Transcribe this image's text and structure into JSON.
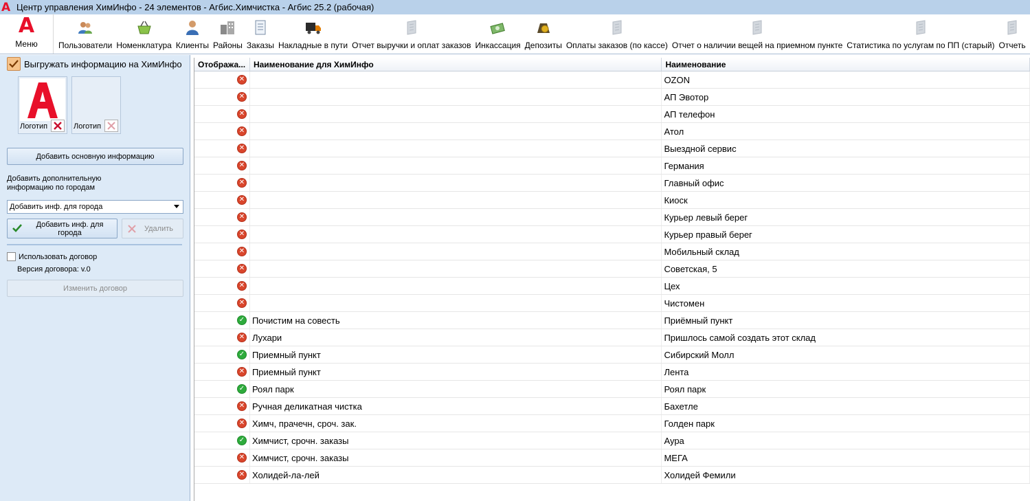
{
  "window": {
    "title": "Центр управления ХимИнфо - 24 элементов - Агбис.Химчистка - Агбис 25.2 (рабочая)"
  },
  "toolbar": {
    "menu_label": "Меню",
    "items": [
      {
        "label": "Пользователи",
        "icon": "users-icon"
      },
      {
        "label": "Номенклатура",
        "icon": "basket-icon"
      },
      {
        "label": "Клиенты",
        "icon": "client-icon"
      },
      {
        "label": "Районы",
        "icon": "buildings-icon"
      },
      {
        "label": "Заказы",
        "icon": "document-icon"
      },
      {
        "label": "Накладные в пути",
        "icon": "truck-icon"
      },
      {
        "label": "Отчет выручки и оплат заказов",
        "icon": "report-icon"
      },
      {
        "label": "Инкассация",
        "icon": "money-icon"
      },
      {
        "label": "Депозиты",
        "icon": "coin-bag-icon"
      },
      {
        "label": "Оплаты заказов (по кассе)",
        "icon": "report-icon"
      },
      {
        "label": "Отчет о наличии вещей на приемном пункте",
        "icon": "report-icon"
      },
      {
        "label": "Статистика по услугам по ПП (старый)",
        "icon": "report-icon"
      },
      {
        "label": "Отчеть",
        "icon": "report-icon"
      }
    ]
  },
  "left": {
    "export_label": "Выгружать информацию на ХимИнфо",
    "logo1_caption": "Логотип",
    "logo2_caption": "Логотип",
    "add_main_info": "Добавить основную информацию",
    "add_extra_info_label": "Добавить дополнительную информацию по городам",
    "city_select_value": "Добавить инф. для города",
    "add_city_button": "Добавить инф. для города",
    "delete_button": "Удалить",
    "use_contract_label": "Использовать договор",
    "contract_version": "Версия договора: v.0",
    "change_contract": "Изменить договор"
  },
  "grid": {
    "columns": [
      "Отобража...",
      "Наименование для ХимИнфо",
      "Наименование"
    ],
    "rows": [
      {
        "shown": false,
        "himinfo_name": "",
        "name": "OZON"
      },
      {
        "shown": false,
        "himinfo_name": "",
        "name": "АП Эвотор"
      },
      {
        "shown": false,
        "himinfo_name": "",
        "name": "АП телефон"
      },
      {
        "shown": false,
        "himinfo_name": "",
        "name": "Атол"
      },
      {
        "shown": false,
        "himinfo_name": "",
        "name": "Выездной сервис"
      },
      {
        "shown": false,
        "himinfo_name": "",
        "name": "Германия"
      },
      {
        "shown": false,
        "himinfo_name": "",
        "name": "Главный офис"
      },
      {
        "shown": false,
        "himinfo_name": "",
        "name": "Киоск"
      },
      {
        "shown": false,
        "himinfo_name": "",
        "name": "Курьер левый берег"
      },
      {
        "shown": false,
        "himinfo_name": "",
        "name": "Курьер правый берег"
      },
      {
        "shown": false,
        "himinfo_name": "",
        "name": "Мобильный склад"
      },
      {
        "shown": false,
        "himinfo_name": "",
        "name": "Советская, 5"
      },
      {
        "shown": false,
        "himinfo_name": "",
        "name": "Цех"
      },
      {
        "shown": false,
        "himinfo_name": "",
        "name": "Чистомен"
      },
      {
        "shown": true,
        "himinfo_name": "Почистим на совесть",
        "name": "Приёмный пункт"
      },
      {
        "shown": false,
        "himinfo_name": "Лухари",
        "name": "Пришлось самой создать этот склад"
      },
      {
        "shown": true,
        "himinfo_name": "Приемный пункт",
        "name": "Сибирский Молл"
      },
      {
        "shown": false,
        "himinfo_name": "Приемный пункт",
        "name": "Лента"
      },
      {
        "shown": true,
        "himinfo_name": "Роял парк",
        "name": "Роял парк"
      },
      {
        "shown": false,
        "himinfo_name": "Ручная деликатная чистка",
        "name": "Бахетле"
      },
      {
        "shown": false,
        "himinfo_name": "Химч, прачечн, сроч. зак.",
        "name": "Голден парк"
      },
      {
        "shown": true,
        "himinfo_name": "Химчист, срочн. заказы",
        "name": "Аура"
      },
      {
        "shown": false,
        "himinfo_name": "Химчист, срочн. заказы",
        "name": "МЕГА"
      },
      {
        "shown": false,
        "himinfo_name": "Холидей-ла-лей",
        "name": "Холидей Фемили"
      }
    ]
  }
}
